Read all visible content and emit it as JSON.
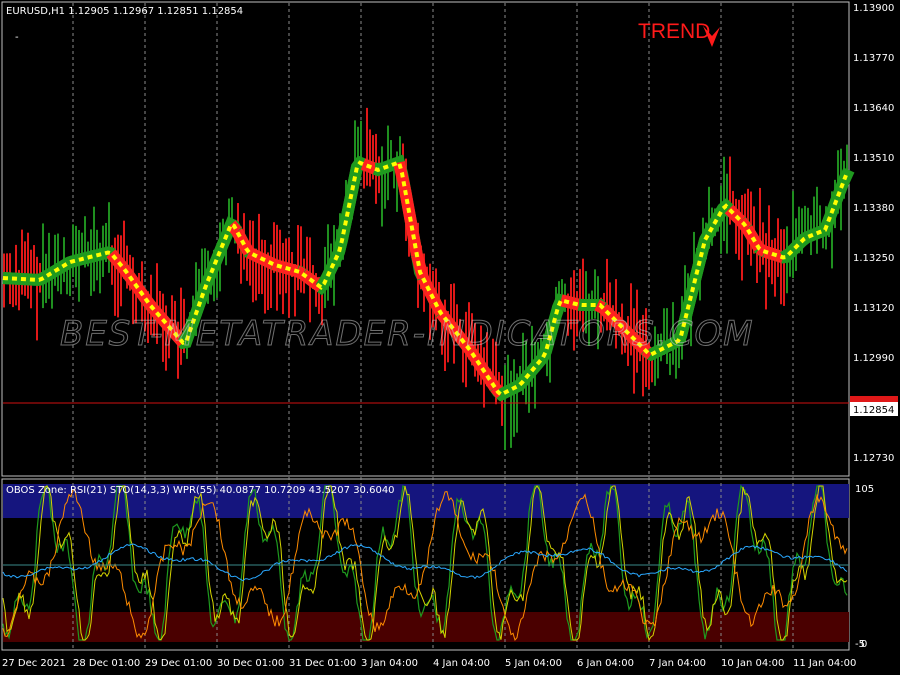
{
  "window": {
    "symbol_line": "EURUSD,H1  1.12905 1.12967 1.12851 1.12854",
    "trend_label": "TREND",
    "watermark": "BEST-METATRADER-INDICATORS.COM"
  },
  "price_axis": {
    "ticks": [
      "1.13900",
      "1.13770",
      "1.13640",
      "1.13510",
      "1.13380",
      "1.13250",
      "1.13120",
      "1.12990",
      "1.12854",
      "1.12730"
    ],
    "current_price": "1.12854"
  },
  "oscillator": {
    "header": "OBOS Zone:  RSI(21)   STO(14,3,3)   WPR(55)   40.0877 10.7209 43.5207 30.6040",
    "top_label": "105",
    "bottom_label": "-5",
    "zero_label": "0"
  },
  "time_axis": {
    "labels": [
      "27 Dec 2021",
      "28 Dec 01:00",
      "29 Dec 01:00",
      "30 Dec 01:00",
      "31 Dec 01:00",
      "3 Jan 04:00",
      "4 Jan 04:00",
      "5 Jan 04:00",
      "6 Jan 04:00",
      "7 Jan 04:00",
      "10 Jan 04:00",
      "11 Jan 04:00"
    ]
  },
  "colors": {
    "background": "#000000",
    "bull_bar": "#1f8f1f",
    "bear_bar": "#e01818",
    "ma_up": "#ffff00",
    "ma_dn_edge": "#ff2020",
    "grid": "#8a8a8a",
    "overbought_zone": "#1a1a8c",
    "oversold_zone": "#5a0000"
  }
}
